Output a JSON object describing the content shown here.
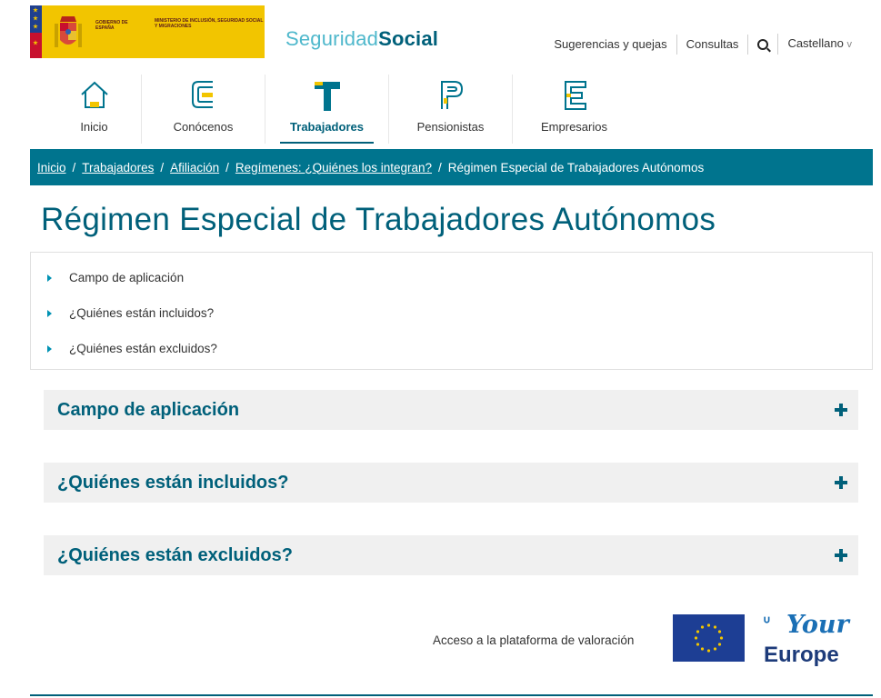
{
  "header": {
    "gov_label": "GOBIERNO DE ESPAÑA",
    "ministry_label": "MINISTERIO DE INCLUSIÓN, SEGURIDAD SOCIAL Y MIGRACIONES",
    "brand_light": "Seguridad",
    "brand_bold": "Social",
    "links": {
      "sugerencias": "Sugerencias y quejas",
      "consultas": "Consultas",
      "idioma": "Castellano",
      "idioma_chevron": "v"
    },
    "colors": {
      "logo_bg": "#f2c500",
      "brand_light": "#4fb8cc",
      "brand_bold": "#00607a"
    }
  },
  "nav": {
    "items": [
      {
        "label": "Inicio",
        "icon": "house-icon",
        "active": false
      },
      {
        "label": "Conócenos",
        "icon": "letter-c-icon",
        "active": false
      },
      {
        "label": "Trabajadores",
        "icon": "letter-t-icon",
        "active": true
      },
      {
        "label": "Pensionistas",
        "icon": "letter-p-icon",
        "active": false
      },
      {
        "label": "Empresarios",
        "icon": "letter-e-icon",
        "active": false
      }
    ]
  },
  "breadcrumb": {
    "items": [
      "Inicio",
      "Trabajadores",
      "Afiliación",
      "Regímenes: ¿Quiénes los integran?",
      "Régimen Especial de Trabajadores Autónomos"
    ],
    "separator": "/",
    "bg_color": "#00748e"
  },
  "page": {
    "title": "Régimen Especial de Trabajadores Autónomos"
  },
  "index": {
    "items": [
      "Campo de aplicación",
      "¿Quiénes están incluidos?",
      "¿Quiénes están excluidos?"
    ]
  },
  "accordion": {
    "sections": [
      {
        "title": "Campo de aplicación",
        "toggle": "+"
      },
      {
        "title": "¿Quiénes están incluidos?",
        "toggle": "+"
      },
      {
        "title": "¿Quiénes están excluidos?",
        "toggle": "+"
      }
    ]
  },
  "footer": {
    "valoracion_link": "Acceso a la plataforma de valoración",
    "your_europe_top": "Your",
    "your_europe_bottom": "Europe",
    "colors": {
      "eu_flag": "#1d3e94",
      "your_europe": "#1a6fb5"
    }
  }
}
